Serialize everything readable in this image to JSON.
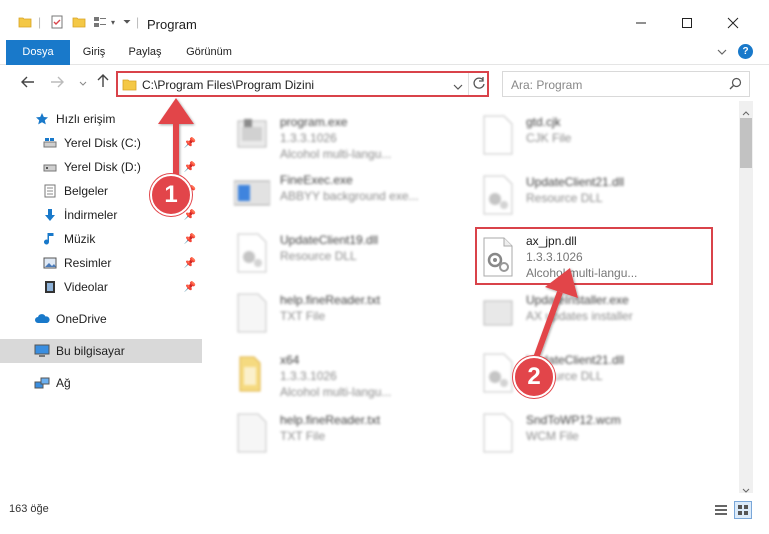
{
  "window": {
    "title": "Program",
    "minimize": "—",
    "maximize": "☐",
    "close": "✕"
  },
  "ribbon": {
    "tabs": [
      "Dosya",
      "Giriş",
      "Paylaş",
      "Görünüm"
    ],
    "expand": "⌄",
    "help": "?"
  },
  "address": {
    "path": "C:\\Program Files\\Program Dizini",
    "search_placeholder": "Ara: Program"
  },
  "sidebar": {
    "items": [
      {
        "label": "Hızlı erişim",
        "icon": "star-icon",
        "pinned": false
      },
      {
        "label": "Yerel Disk (C:)",
        "icon": "drive-icon",
        "pinned": true
      },
      {
        "label": "Yerel Disk (D:)",
        "icon": "drive-icon",
        "pinned": true
      },
      {
        "label": "Belgeler",
        "icon": "documents-icon",
        "pinned": true
      },
      {
        "label": "İndirmeler",
        "icon": "download-icon",
        "pinned": true
      },
      {
        "label": "Müzik",
        "icon": "music-icon",
        "pinned": true
      },
      {
        "label": "Resimler",
        "icon": "pictures-icon",
        "pinned": true
      },
      {
        "label": "Videolar",
        "icon": "videos-icon",
        "pinned": true
      },
      {
        "label": "OneDrive",
        "icon": "cloud-icon",
        "pinned": false
      },
      {
        "label": "Bu bilgisayar",
        "icon": "computer-icon",
        "pinned": false
      },
      {
        "label": "Ağ",
        "icon": "network-icon",
        "pinned": false
      }
    ]
  },
  "files": {
    "left": [
      {
        "name": "program.exe",
        "line2": "1.3.3.1026",
        "line3": "Alcohol multi-langu..."
      },
      {
        "name": "FineExec.exe",
        "line2": "ABBYY background exe...",
        "line3": ""
      },
      {
        "name": "UpdateClient19.dll",
        "line2": "Resource DLL",
        "line3": ""
      },
      {
        "name": "help.fineReader.txt",
        "line2": "TXT File",
        "line3": ""
      },
      {
        "name": "x64",
        "line2": "1.3.3.1026",
        "line3": "Alcohol multi-langu..."
      },
      {
        "name": "help.fineReader.txt",
        "line2": "TXT File",
        "line3": ""
      }
    ],
    "right": [
      {
        "name": "gtd.cjk",
        "line2": "CJK File",
        "line3": ""
      },
      {
        "name": "UpdateClient21.dll",
        "line2": "Resource DLL",
        "line3": ""
      },
      {
        "name": "ax_jpn.dll",
        "line2": "1.3.3.1026",
        "line3": "Alcohol multi-langu..."
      },
      {
        "name": "UpdateInstaller.exe",
        "line2": "AX updates installer",
        "line3": ""
      },
      {
        "name": "UpdateClient21.dll",
        "line2": "Resource DLL",
        "line3": ""
      },
      {
        "name": "SndToWP12.wcm",
        "line2": "WCM File",
        "line3": ""
      }
    ]
  },
  "status": {
    "count": "163 öğe"
  },
  "callouts": [
    "1",
    "2"
  ],
  "colors": {
    "accent": "#1979ca",
    "highlight": "#d9434a",
    "callout": "#e2454a"
  }
}
